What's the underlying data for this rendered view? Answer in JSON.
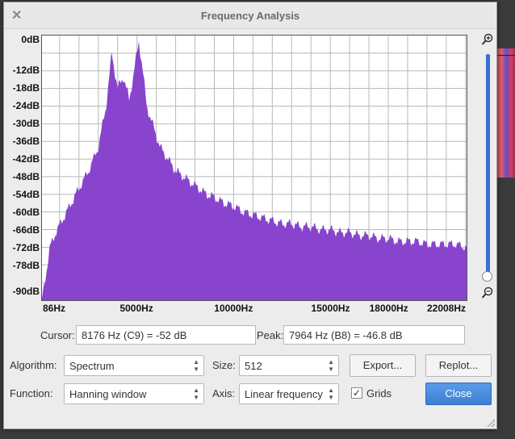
{
  "window": {
    "title": "Frequency Analysis"
  },
  "chart_data": {
    "type": "area",
    "color": "#8844cc",
    "grid": true,
    "xlim": [
      86,
      22050
    ],
    "ylim": [
      -90,
      0
    ],
    "yticks": [
      "0dB",
      "-12dB",
      "-18dB",
      "-24dB",
      "-30dB",
      "-36dB",
      "-42dB",
      "-48dB",
      "-54dB",
      "-60dB",
      "-66dB",
      "-72dB",
      "-78dB",
      "-90dB"
    ],
    "ytick_values": [
      0,
      -12,
      -18,
      -24,
      -30,
      -36,
      -42,
      -48,
      -54,
      -60,
      -66,
      -72,
      -78,
      -90
    ],
    "xticks": [
      "86Hz",
      "5000Hz",
      "10000Hz",
      "15000Hz",
      "18000Hz",
      "22008Hz"
    ],
    "xtick_values": [
      86,
      5000,
      10000,
      15000,
      18000,
      22008
    ],
    "x": [
      86,
      500,
      800,
      1200,
      1600,
      2000,
      2500,
      3000,
      3400,
      3700,
      4000,
      4300,
      4600,
      4900,
      5100,
      5300,
      5500,
      5800,
      6200,
      6600,
      7000,
      7400,
      7800,
      8200,
      8600,
      9000,
      9500,
      10000,
      10500,
      11000,
      11500,
      12000,
      12500,
      13000,
      13500,
      14000,
      14500,
      15000,
      15500,
      16000,
      16500,
      17000,
      17500,
      18000,
      18500,
      19000,
      19500,
      20000,
      20500,
      21000,
      21500,
      22050
    ],
    "y": [
      -90,
      -72,
      -67,
      -62,
      -57,
      -52,
      -46,
      -38,
      -24,
      -6,
      -18,
      -14,
      -22,
      -10,
      -2,
      -12,
      -24,
      -30,
      -38,
      -42,
      -46,
      -48,
      -50,
      -52,
      -54,
      -55,
      -57,
      -58,
      -60,
      -61,
      -62,
      -63,
      -64,
      -64,
      -65,
      -65,
      -66,
      -66,
      -67,
      -67,
      -68,
      -68,
      -69,
      -69,
      -70,
      -70,
      -70,
      -71,
      -71,
      -71,
      -71,
      -72
    ]
  },
  "readout": {
    "cursor_label": "Cursor:",
    "cursor_value": "8176 Hz (C9) = -52 dB",
    "peak_label": "Peak:",
    "peak_value": "7964 Hz (B8) = -46.8 dB"
  },
  "controls": {
    "algorithm_label": "Algorithm:",
    "algorithm_value": "Spectrum",
    "size_label": "Size:",
    "size_value": "512",
    "function_label": "Function:",
    "function_value": "Hanning window",
    "axis_label": "Axis:",
    "axis_value": "Linear frequency",
    "grids_label": "Grids",
    "grids_checked": true,
    "export_label": "Export...",
    "replot_label": "Replot...",
    "close_label": "Close"
  }
}
